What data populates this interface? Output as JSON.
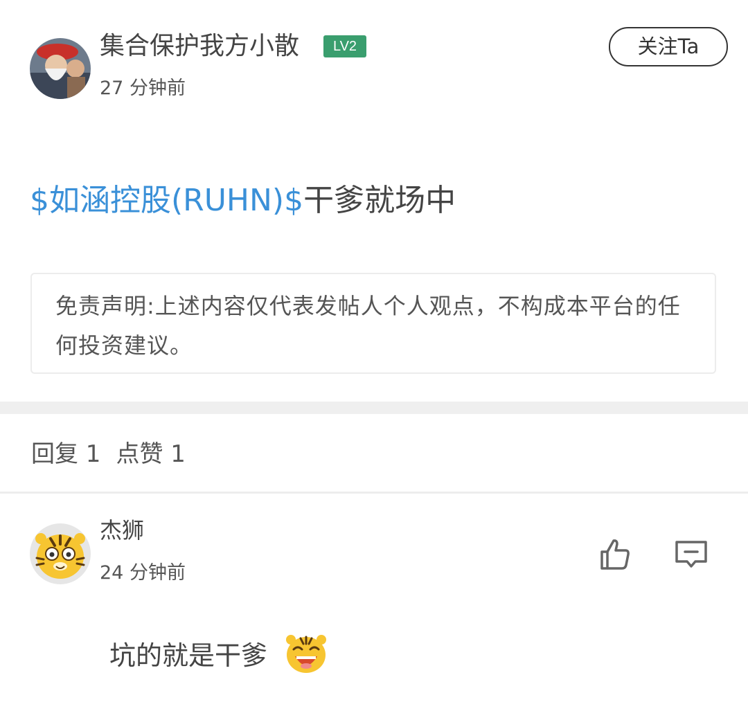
{
  "post": {
    "author": {
      "name": "集合保护我方小散",
      "level": "LV2",
      "avatar_icon": "user-avatar-photo"
    },
    "time": "27 分钟前",
    "follow_label": "关注Ta",
    "stock_tag": "$如涵控股(RUHN)$",
    "content": "干爹就场中",
    "disclaimer": "免责声明:上述内容仅代表发帖人个人观点，不构成本平台的任何投资建议。"
  },
  "stats": {
    "replies": "回复 1",
    "likes": "点赞 1"
  },
  "reply": {
    "author": {
      "name": "杰狮",
      "avatar_icon": "tiger-avatar"
    },
    "time": "24 分钟前",
    "text": "坑的就是干爹",
    "emoji_icon": "laughing-tiger-emoji",
    "like_icon": "thumbs-up-icon",
    "comment_icon": "comment-icon"
  },
  "colors": {
    "link": "#3a90d8",
    "badge": "#3a9e6e",
    "divider": "#efefef"
  }
}
